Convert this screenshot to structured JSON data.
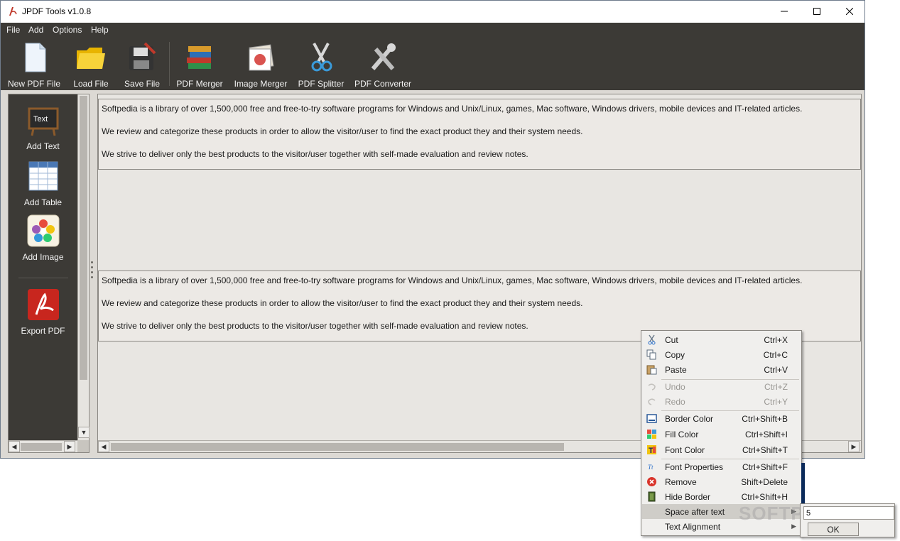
{
  "window": {
    "title": "JPDF Tools v1.0.8"
  },
  "menu": [
    "File",
    "Add",
    "Options",
    "Help"
  ],
  "toolbar": [
    {
      "label": "New PDF File",
      "icon": "new-pdf-file-icon"
    },
    {
      "label": "Load File",
      "icon": "folder-icon"
    },
    {
      "label": "Save File",
      "icon": "floppy-disk-icon"
    },
    {
      "label": "PDF Merger",
      "icon": "book-stack-icon"
    },
    {
      "label": "Image Merger",
      "icon": "image-stack-icon"
    },
    {
      "label": "PDF Splitter",
      "icon": "scissors-icon"
    },
    {
      "label": "PDF Converter",
      "icon": "tools-icon"
    }
  ],
  "sidebar": [
    {
      "label": "Add Text",
      "icon": "text-board-icon"
    },
    {
      "label": "Add Table",
      "icon": "table-icon"
    },
    {
      "label": "Add Image",
      "icon": "image-flower-icon"
    },
    {
      "label": "Export PDF",
      "icon": "acrobat-icon"
    }
  ],
  "text_blocks": [
    {
      "lines": [
        "Softpedia is a library of over 1,500,000 free and free-to-try software programs for Windows and Unix/Linux, games, Mac software, Windows drivers, mobile devices and IT-related articles.",
        "We review and categorize these products in order to allow the visitor/user to find the exact product they and their system needs.",
        "We strive to deliver only the best products to the visitor/user together with self-made evaluation and review notes."
      ]
    },
    {
      "lines": [
        "Softpedia is a library of over 1,500,000 free and free-to-try software programs for Windows and Unix/Linux, games, Mac software, Windows drivers, mobile devices and IT-related articles.",
        "We review and categorize these products in order to allow the visitor/user to find the exact product they and their system needs.",
        "We strive to deliver only the best products to the visitor/user together with self-made evaluation and review notes."
      ]
    }
  ],
  "context_menu": {
    "items": [
      {
        "label": "Cut",
        "shortcut": "Ctrl+X",
        "icon": "scissors-icon",
        "enabled": true
      },
      {
        "label": "Copy",
        "shortcut": "Ctrl+C",
        "icon": "copy-icon",
        "enabled": true
      },
      {
        "label": "Paste",
        "shortcut": "Ctrl+V",
        "icon": "paste-icon",
        "enabled": true
      },
      {
        "label": "Undo",
        "shortcut": "Ctrl+Z",
        "icon": "undo-icon",
        "enabled": false
      },
      {
        "label": "Redo",
        "shortcut": "Ctrl+Y",
        "icon": "redo-icon",
        "enabled": false
      },
      {
        "label": "Border Color",
        "shortcut": "Ctrl+Shift+B",
        "icon": "border-color-icon",
        "enabled": true
      },
      {
        "label": "Fill Color",
        "shortcut": "Ctrl+Shift+I",
        "icon": "fill-color-icon",
        "enabled": true
      },
      {
        "label": "Font Color",
        "shortcut": "Ctrl+Shift+T",
        "icon": "font-color-icon",
        "enabled": true
      },
      {
        "label": "Font Properties",
        "shortcut": "Ctrl+Shift+F",
        "icon": "font-properties-icon",
        "enabled": true
      },
      {
        "label": "Remove",
        "shortcut": "Shift+Delete",
        "icon": "remove-icon",
        "enabled": true
      },
      {
        "label": "Hide Border",
        "shortcut": "Ctrl+Shift+H",
        "icon": "hide-border-icon",
        "enabled": true
      },
      {
        "label": "Space after text",
        "shortcut": "",
        "icon": "",
        "enabled": true
      },
      {
        "label": "Text Alignment",
        "shortcut": "",
        "icon": "",
        "enabled": true
      }
    ]
  },
  "submenu": {
    "space_value": "5",
    "ok_label": "OK"
  },
  "watermark": "SOFTPEDIA",
  "colors": {
    "toolbar_bg": "#3c3a36",
    "content_bg": "#dcd9d4",
    "highlight": "#cfcdc8"
  }
}
